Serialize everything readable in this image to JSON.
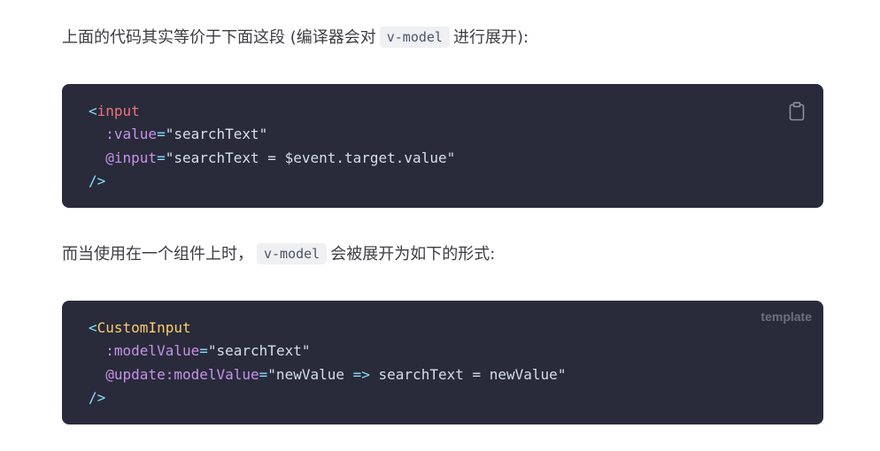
{
  "paragraph1": {
    "before": "上面的代码其实等价于下面这段 (编译器会对",
    "code": "v-model",
    "after": "进行展开):"
  },
  "code_block_1": {
    "copy_icon": "clipboard-icon",
    "lines": [
      [
        {
          "t": "<",
          "k": "punct"
        },
        {
          "t": "input",
          "k": "tag"
        }
      ],
      [
        {
          "t": "  ",
          "k": "plain"
        },
        {
          "t": ":value",
          "k": "attr"
        },
        {
          "t": "=",
          "k": "op"
        },
        {
          "t": "\"searchText\"",
          "k": "plain"
        }
      ],
      [
        {
          "t": "  ",
          "k": "plain"
        },
        {
          "t": "@input",
          "k": "attr"
        },
        {
          "t": "=",
          "k": "op"
        },
        {
          "t": "\"searchText = $event.target.value\"",
          "k": "plain"
        }
      ],
      [
        {
          "t": "/>",
          "k": "punct"
        }
      ]
    ]
  },
  "paragraph2": {
    "before": "而当使用在一个组件上时，",
    "code": "v-model",
    "after": "会被展开为如下的形式:"
  },
  "code_block_2": {
    "lang": "template",
    "lines": [
      [
        {
          "t": "<",
          "k": "punct"
        },
        {
          "t": "CustomInput",
          "k": "comp"
        }
      ],
      [
        {
          "t": "  ",
          "k": "plain"
        },
        {
          "t": ":modelValue",
          "k": "attr"
        },
        {
          "t": "=",
          "k": "op"
        },
        {
          "t": "\"searchText\"",
          "k": "plain"
        }
      ],
      [
        {
          "t": "  ",
          "k": "plain"
        },
        {
          "t": "@update:modelValue",
          "k": "attr"
        },
        {
          "t": "=",
          "k": "op"
        },
        {
          "t": "\"newValue ",
          "k": "plain"
        },
        {
          "t": "=>",
          "k": "op"
        },
        {
          "t": " searchText = newValue\"",
          "k": "plain"
        }
      ],
      [
        {
          "t": "/>",
          "k": "punct"
        }
      ]
    ]
  }
}
